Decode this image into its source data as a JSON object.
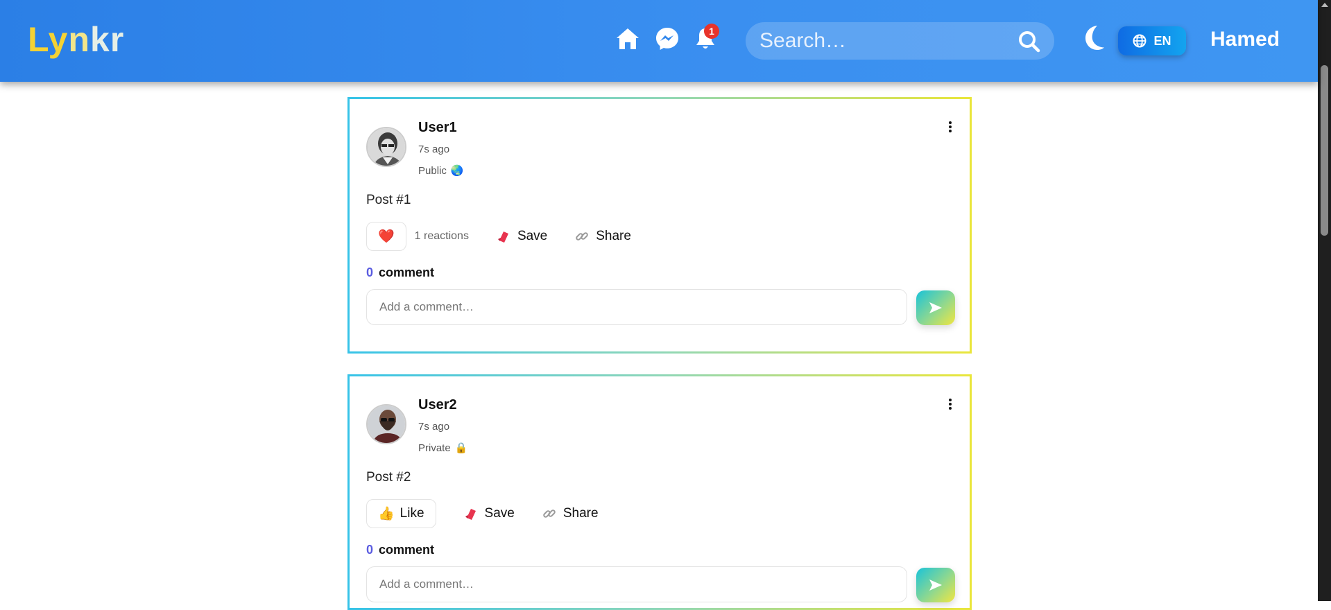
{
  "header": {
    "logo": {
      "part1": "Ly",
      "part2": "n",
      "part3": "kr"
    },
    "notifications_count": "1",
    "search": {
      "placeholder": "Search…"
    },
    "language": "EN",
    "username": "Hamed"
  },
  "posts": [
    {
      "user": "User1",
      "time": "7s ago",
      "visibility": "Public",
      "visibility_icon": "🌏",
      "content": "Post #1",
      "reaction_emoji": "❤️",
      "reactions_text": "1 reactions",
      "save_label": "Save",
      "share_label": "Share",
      "comment_count": "0",
      "comment_label": "comment",
      "comment_placeholder": "Add a comment…"
    },
    {
      "user": "User2",
      "time": "7s ago",
      "visibility": "Private",
      "visibility_icon": "🔒",
      "content": "Post #2",
      "like_emoji": "👍",
      "like_label": "Like",
      "save_label": "Save",
      "share_label": "Share",
      "comment_count": "0",
      "comment_label": "comment",
      "comment_placeholder": "Add a comment…"
    }
  ],
  "colors": {
    "header_start": "#2b7fe6",
    "header_end": "#3f96f2",
    "accent_count": "#5a5ce0",
    "badge": "#e8342b"
  }
}
